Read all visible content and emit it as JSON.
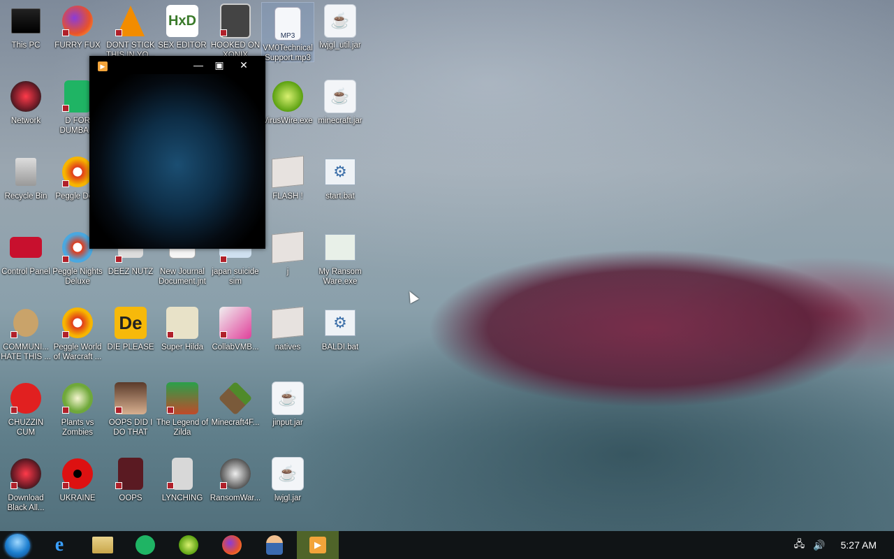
{
  "desktop": {
    "icons": [
      {
        "label": "This PC",
        "icon": "computer-icon"
      },
      {
        "label": "FURRY FUX",
        "icon": "firefox-icon"
      },
      {
        "label": "DONT STICK THIS IN YO...",
        "icon": "vlc-icon"
      },
      {
        "label": "SEX EDITOR",
        "icon": "hex-editor-icon"
      },
      {
        "label": "HOOKED ON XONIX",
        "icon": "game-icon"
      },
      {
        "label": "VM0TechnicalSupport.mp3",
        "icon": "mp3-file-icon"
      },
      {
        "label": "lwjgl_util.jar",
        "icon": "java-icon"
      },
      {
        "label": "Network",
        "icon": "network-icon"
      },
      {
        "label": "D FOR DUMBA...",
        "icon": "sheets-icon"
      },
      {
        "label": "VirusWire.exe",
        "icon": "limewire-icon"
      },
      {
        "label": "minecraft.jar",
        "icon": "java-icon"
      },
      {
        "label": "Recycle Bin",
        "icon": "recycle-bin-icon"
      },
      {
        "label": "Peggle De...",
        "icon": "peggle-icon"
      },
      {
        "label": "FLASH !",
        "icon": "folder-icon"
      },
      {
        "label": "start.bat",
        "icon": "batch-file-icon"
      },
      {
        "label": "Control Panel",
        "icon": "control-panel-icon"
      },
      {
        "label": "Peggle Nights Deluxe",
        "icon": "peggle-icon"
      },
      {
        "label": "DEEZ NUTZ",
        "icon": "app-icon"
      },
      {
        "label": "New Journal Document.jnt",
        "icon": "journal-icon"
      },
      {
        "label": "japan suicide sim",
        "icon": "game-icon"
      },
      {
        "label": "j",
        "icon": "folder-icon"
      },
      {
        "label": "My Ransom Ware.exe",
        "icon": "exe-icon"
      },
      {
        "label": "COMMUNI... HATE THIS ...",
        "icon": "money-bag-icon"
      },
      {
        "label": "Peggle World of Warcraft ...",
        "icon": "peggle-icon"
      },
      {
        "label": "DIE PLEASE",
        "icon": "de-icon"
      },
      {
        "label": "Super Hilda",
        "icon": "pixel-game-icon"
      },
      {
        "label": "CollabVMB...",
        "icon": "collabvm-icon"
      },
      {
        "label": "natives",
        "icon": "folder-icon"
      },
      {
        "label": "BALDI.bat",
        "icon": "batch-file-icon"
      },
      {
        "label": "CHUZZIN CUM",
        "icon": "chuzzle-icon"
      },
      {
        "label": "Plants vs Zombies",
        "icon": "pvz-icon"
      },
      {
        "label": "OOPS DID I DO THAT",
        "icon": "portrait-icon"
      },
      {
        "label": "The Legend of Zilda",
        "icon": "zelda-icon"
      },
      {
        "label": "Minecraft4F...",
        "icon": "minecraft-icon"
      },
      {
        "label": "jinput.jar",
        "icon": "java-icon"
      },
      {
        "label": "Download Black All...",
        "icon": "network-icon"
      },
      {
        "label": "UKRAINE",
        "icon": "radiation-icon"
      },
      {
        "label": "OOPS",
        "icon": "app-icon"
      },
      {
        "label": "LYNCHING",
        "icon": "zipper-icon"
      },
      {
        "label": "RansomWar...",
        "icon": "skull-icon"
      },
      {
        "label": "lwjgl.jar",
        "icon": "java-icon"
      }
    ]
  },
  "player": {
    "minimize_glyph": "—",
    "maximize_glyph": "▣",
    "close_glyph": "✕"
  },
  "taskbar": {
    "items": [
      "internet-explorer-icon",
      "file-explorer-icon",
      "sheets-icon",
      "limewire-icon",
      "firefox-icon",
      "user-icon",
      "media-player-icon"
    ],
    "active_item": "media-player-icon",
    "network_glyph": "🖧",
    "volume_glyph": "🔊",
    "clock": "5:27 AM"
  },
  "colors": {
    "taskbar": "#101416",
    "active_task": "#4f6429"
  }
}
